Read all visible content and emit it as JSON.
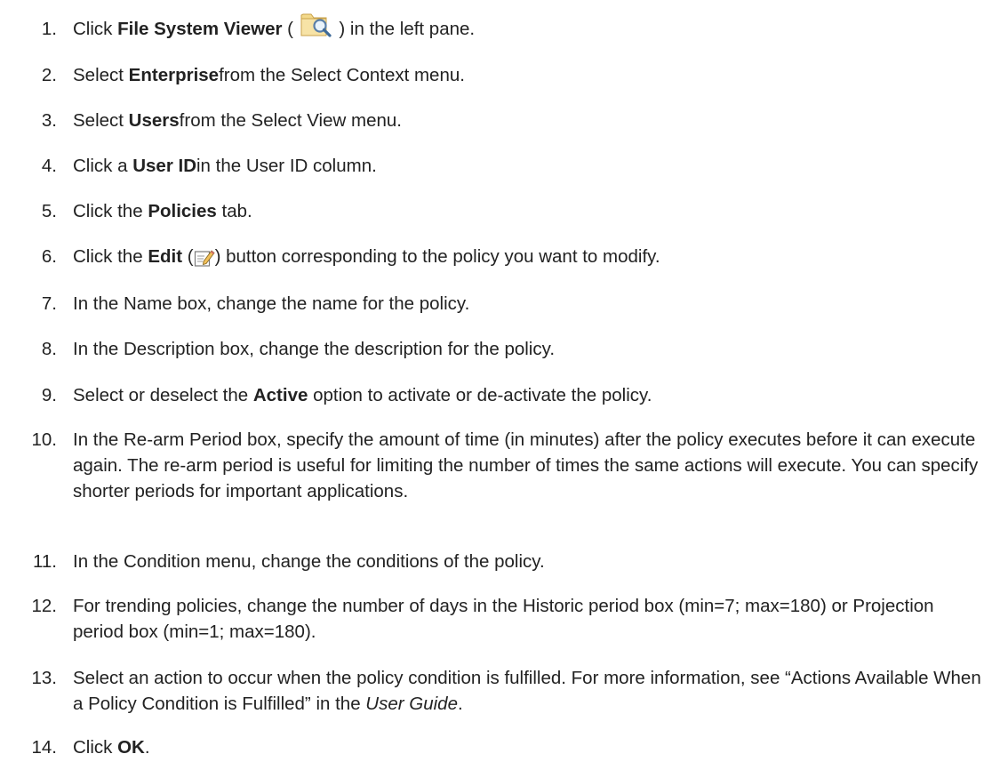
{
  "steps": [
    {
      "num": "1.",
      "parts": [
        {
          "text": "Click "
        },
        {
          "text": "File System Viewer",
          "b": true
        },
        {
          "text": " ( "
        },
        {
          "icon": "folder-magnifier-icon"
        },
        {
          "text": " ) in the left pane."
        }
      ]
    },
    {
      "num": "2.",
      "parts": [
        {
          "text": "Select "
        },
        {
          "text": "Enterprise",
          "b": true
        },
        {
          "text": "from the Select Context menu."
        }
      ]
    },
    {
      "num": "3.",
      "parts": [
        {
          "text": "Select "
        },
        {
          "text": "Users",
          "b": true
        },
        {
          "text": "from the Select View menu."
        }
      ]
    },
    {
      "num": "4.",
      "parts": [
        {
          "text": "Click a "
        },
        {
          "text": "User ID",
          "b": true
        },
        {
          "text": "in the User ID column."
        }
      ]
    },
    {
      "num": "5.",
      "parts": [
        {
          "text": "Click the "
        },
        {
          "text": "Policies",
          "b": true
        },
        {
          "text": " tab."
        }
      ]
    },
    {
      "num": "6.",
      "parts": [
        {
          "text": "Click the "
        },
        {
          "text": "Edit",
          "b": true
        },
        {
          "text": " ("
        },
        {
          "icon": "edit-pencil-icon"
        },
        {
          "text": ") button corresponding to the policy you want to modify."
        }
      ]
    },
    {
      "num": "7.",
      "parts": [
        {
          "text": "In the Name box, change the name for the policy."
        }
      ]
    },
    {
      "num": "8.",
      "parts": [
        {
          "text": "In the Description box, change the description for the policy."
        }
      ]
    },
    {
      "num": "9.",
      "parts": [
        {
          "text": "Select or deselect the "
        },
        {
          "text": "Active",
          "b": true
        },
        {
          "text": " option to activate or de-activate the policy."
        }
      ]
    },
    {
      "num": "10.",
      "parts": [
        {
          "text": "In the Re-arm Period box, specify the amount of time (in minutes) after the policy executes before it can execute again. The re-arm period is useful for limiting the number of times the same actions will execute. You can specify shorter periods for important applications."
        }
      ]
    },
    {
      "num": "11.",
      "parts": [
        {
          "text": "In the Condition menu, change the conditions of the policy."
        }
      ]
    },
    {
      "num": "12.",
      "parts": [
        {
          "text": "For trending policies, change the number of days in the Historic period box (min=7; max=180) or Projection period box (min=1; max=180)."
        }
      ]
    },
    {
      "num": "13.",
      "parts": [
        {
          "text": "Select an action to occur when the policy condition is fulfilled. For more information, see “Actions Available When a Policy Condition is Fulfilled” in the "
        },
        {
          "text": "User Guide",
          "i": true
        },
        {
          "text": "."
        }
      ]
    },
    {
      "num": "14.",
      "parts": [
        {
          "text": "Click "
        },
        {
          "text": "OK",
          "b": true
        },
        {
          "text": "."
        }
      ]
    }
  ]
}
